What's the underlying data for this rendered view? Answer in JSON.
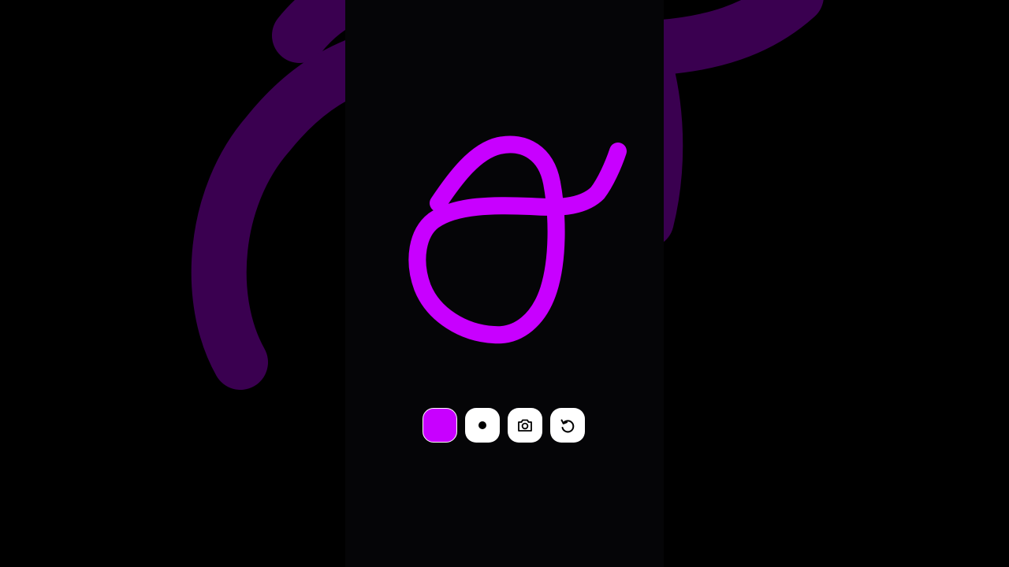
{
  "app": {
    "background_color": "#000000",
    "canvas_color": "#050507"
  },
  "drawing": {
    "stroke_color": "#c800ff",
    "background_stroke_color": "#3a0050"
  },
  "toolbar": {
    "buttons": [
      {
        "name": "color-swatch-button",
        "icon": "color-swatch",
        "color": "#c800ff"
      },
      {
        "name": "brush-size-button",
        "icon": "dot-icon"
      },
      {
        "name": "screenshot-button",
        "icon": "camera-icon"
      },
      {
        "name": "reset-button",
        "icon": "rotate-ccw-icon"
      }
    ]
  }
}
